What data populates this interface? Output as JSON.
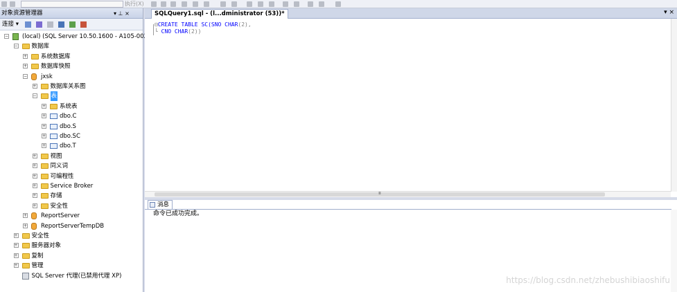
{
  "toolbar": {
    "execute_label": "执行(X)"
  },
  "object_explorer": {
    "title": "对象资源管理器",
    "pin_glyph": "▾ ⊥ ×",
    "connect_label": "连接 ▾",
    "tree": [
      {
        "id": "server",
        "label": "(local) (SQL Server 10.50.1600 - A105-002",
        "icon": "server-icon",
        "expander": "⊟",
        "level": 0
      },
      {
        "id": "databases",
        "label": "数据库",
        "icon": "folder-icon",
        "expander": "⊟",
        "level": 1
      },
      {
        "id": "sys-dbs",
        "label": "系统数据库",
        "icon": "folder-icon",
        "expander": "⊞",
        "level": 2
      },
      {
        "id": "db-snapshots",
        "label": "数据库快照",
        "icon": "folder-icon",
        "expander": "⊞",
        "level": 2
      },
      {
        "id": "jxsk",
        "label": "jxsk",
        "icon": "database-icon",
        "expander": "⊟",
        "level": 2
      },
      {
        "id": "diagrams",
        "label": "数据库关系图",
        "icon": "folder-icon",
        "expander": "⊞",
        "level": 3
      },
      {
        "id": "tables",
        "label": "表",
        "icon": "folder-icon",
        "expander": "⊟",
        "level": 3,
        "selected": true
      },
      {
        "id": "sys-tables",
        "label": "系统表",
        "icon": "folder-icon",
        "expander": "⊞",
        "level": 4
      },
      {
        "id": "dbo-c",
        "label": "dbo.C",
        "icon": "table-icon",
        "expander": "⊞",
        "level": 4
      },
      {
        "id": "dbo-s",
        "label": "dbo.S",
        "icon": "table-icon",
        "expander": "⊞",
        "level": 4
      },
      {
        "id": "dbo-sc",
        "label": "dbo.SC",
        "icon": "table-icon",
        "expander": "⊞",
        "level": 4
      },
      {
        "id": "dbo-t",
        "label": "dbo.T",
        "icon": "table-icon",
        "expander": "⊞",
        "level": 4
      },
      {
        "id": "views",
        "label": "视图",
        "icon": "folder-icon",
        "expander": "⊞",
        "level": 3
      },
      {
        "id": "synonyms",
        "label": "同义词",
        "icon": "folder-icon",
        "expander": "⊞",
        "level": 3
      },
      {
        "id": "programmability",
        "label": "可编程性",
        "icon": "folder-icon",
        "expander": "⊞",
        "level": 3
      },
      {
        "id": "service-broker",
        "label": "Service Broker",
        "icon": "folder-icon",
        "expander": "⊞",
        "level": 3
      },
      {
        "id": "storage",
        "label": "存储",
        "icon": "folder-icon",
        "expander": "⊞",
        "level": 3
      },
      {
        "id": "db-security",
        "label": "安全性",
        "icon": "folder-icon",
        "expander": "⊞",
        "level": 3
      },
      {
        "id": "reportserver",
        "label": "ReportServer",
        "icon": "database-icon",
        "expander": "⊞",
        "level": 2
      },
      {
        "id": "reportservertempdb",
        "label": "ReportServerTempDB",
        "icon": "database-icon",
        "expander": "⊞",
        "level": 2
      },
      {
        "id": "security",
        "label": "安全性",
        "icon": "folder-icon",
        "expander": "⊞",
        "level": 1
      },
      {
        "id": "server-objects",
        "label": "服务器对象",
        "icon": "folder-icon",
        "expander": "⊞",
        "level": 1
      },
      {
        "id": "replication",
        "label": "复制",
        "icon": "folder-icon",
        "expander": "⊞",
        "level": 1
      },
      {
        "id": "management",
        "label": "管理",
        "icon": "folder-icon",
        "expander": "⊞",
        "level": 1
      },
      {
        "id": "sql-agent",
        "label": "SQL Server 代理(已禁用代理 XP)",
        "icon": "agent-icon",
        "expander": "",
        "level": 1
      }
    ]
  },
  "editor": {
    "tab_title": "SQLQuery1.sql - (l...dministrator (53))*",
    "tab_controls": "▾ ×",
    "code_line1": {
      "kw1": "CREATE TABLE",
      "ident": " SC(SNO ",
      "type": "CHAR",
      "rest": "(2),"
    },
    "code_line2": {
      "ident": "CNO ",
      "type": "CHAR",
      "rest": "(2))"
    },
    "hscroll_thumb": "Ⅲ"
  },
  "messages": {
    "tab_label": "消息",
    "text": "命令已成功完成。"
  },
  "watermark": "https://blog.csdn.net/zhebushibiaoshifu"
}
